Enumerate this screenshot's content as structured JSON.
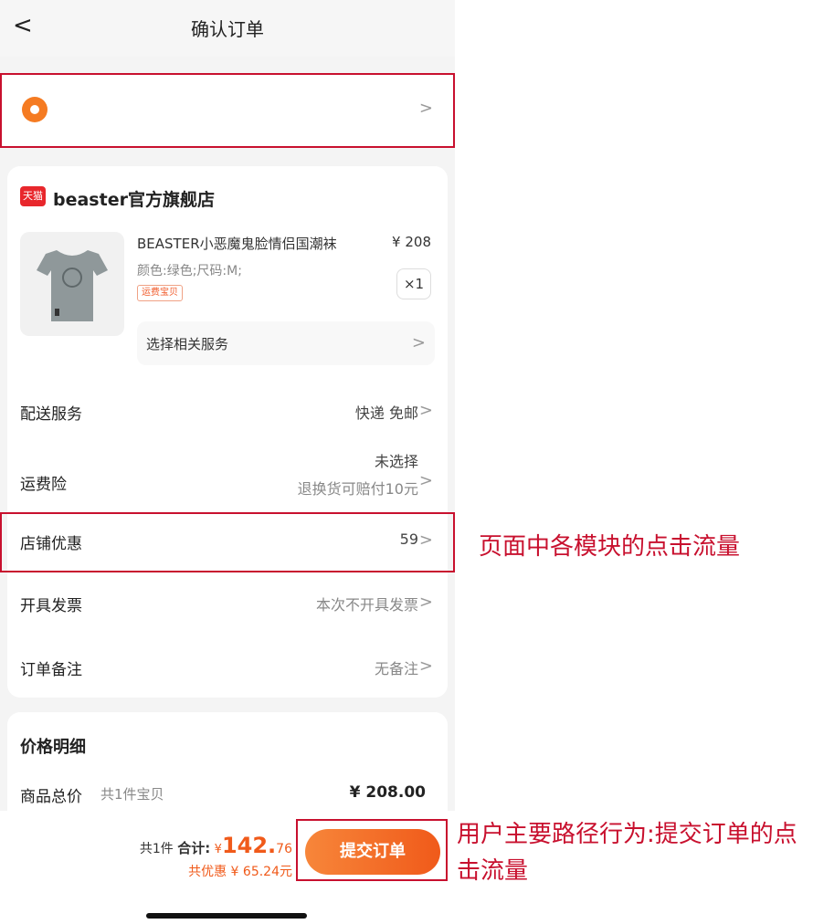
{
  "header": {
    "back_glyph": "<",
    "title": "确认订单"
  },
  "address": {
    "icon": "location-pin-icon",
    "chevron": ">"
  },
  "store": {
    "badge": "天猫",
    "name": "beaster官方旗舰店"
  },
  "product": {
    "title": "BEASTER小恶魔鬼脸情侣国潮袜",
    "price": "¥ 208",
    "spec": "颜色:绿色;尺码:M;",
    "tag": "运费宝贝",
    "qty": "×1",
    "image_icon": "tshirt-icon"
  },
  "service": {
    "label": "选择相关服务"
  },
  "rows": {
    "shipping": {
      "label": "配送服务",
      "value": "快递 免邮"
    },
    "insurance": {
      "label": "运费险",
      "value": "未选择",
      "sub": "退换货可赔付10元"
    },
    "coupon": {
      "label": "店铺优惠",
      "value": "59"
    },
    "invoice": {
      "label": "开具发票",
      "value": "本次不开具发票"
    },
    "note": {
      "label": "订单备注",
      "value": "无备注"
    }
  },
  "price_detail": {
    "title": "价格明细",
    "goods_label": "商品总价",
    "goods_count": "共1件宝贝",
    "goods_value": "¥ 208.00"
  },
  "bottom": {
    "count": "共1件",
    "total_label": "合计:",
    "currency": "¥",
    "total_int": "142.",
    "total_dec": "76",
    "discount": "共优惠 ¥ 65.24元",
    "submit": "提交订单"
  },
  "annotations": {
    "module_clicks": "页面中各模块的点击流量",
    "submit_clicks": "用户主要路径行为:提交订单的点击流量"
  },
  "colors": {
    "accent": "#f05a1a",
    "highlight": "#c8102e",
    "store_badge": "#e8272c"
  }
}
